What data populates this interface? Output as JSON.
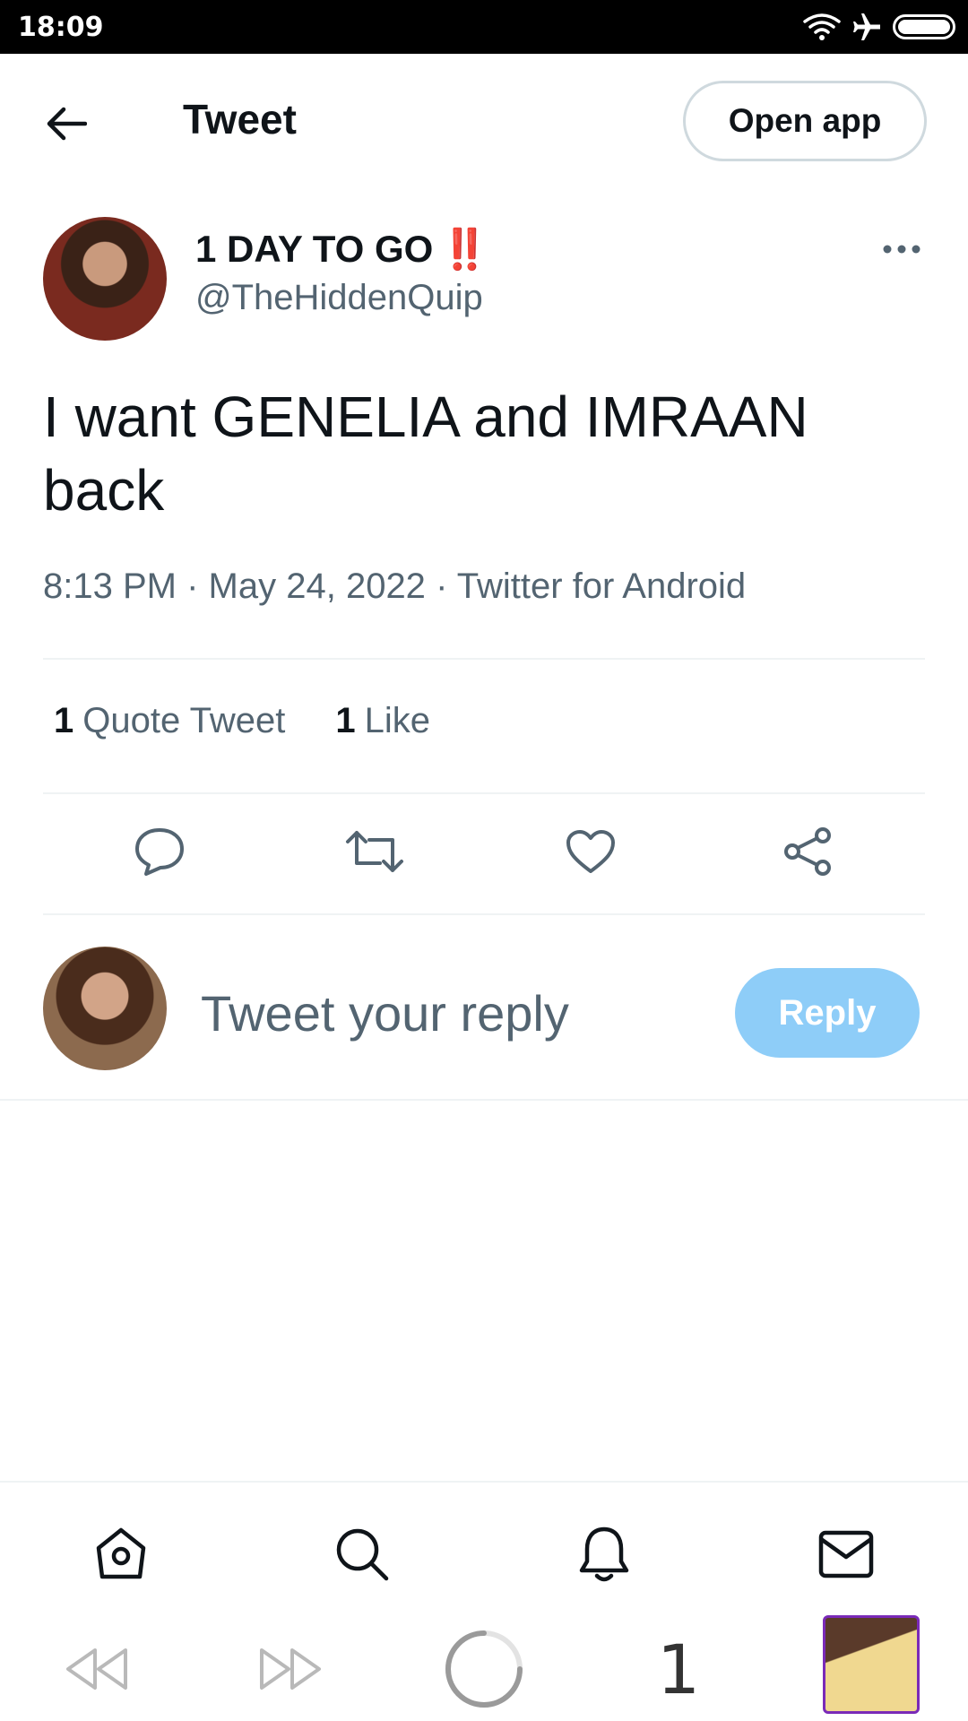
{
  "status_bar": {
    "time": "18:09"
  },
  "header": {
    "title": "Tweet",
    "open_app_label": "Open app"
  },
  "tweet": {
    "display_name": "1 DAY TO GO",
    "display_name_emoji": "‼️",
    "handle": "@TheHiddenQuip",
    "text": "I want GENELIA and IMRAAN back",
    "time": "8:13 PM",
    "date": "May 24, 2022",
    "source": "Twitter for Android",
    "separator": "·",
    "stats": {
      "quote_count": "1",
      "quote_label": "Quote Tweet",
      "like_count": "1",
      "like_label": "Like"
    }
  },
  "reply_box": {
    "placeholder": "Tweet your reply",
    "button_label": "Reply"
  },
  "browser": {
    "tab_count": "1"
  },
  "colors": {
    "accent_reply_button": "#8ecdf8",
    "secondary_text": "#536471",
    "primary_text": "#0f1419",
    "emoji_red": "#d0021b"
  },
  "icons": {
    "actions": [
      "reply-icon",
      "retweet-icon",
      "like-icon",
      "share-icon"
    ],
    "bottom_nav": [
      "home-icon",
      "search-icon",
      "notifications-icon",
      "messages-icon"
    ],
    "browser": [
      "back-icon",
      "forward-icon",
      "loading-icon"
    ]
  }
}
